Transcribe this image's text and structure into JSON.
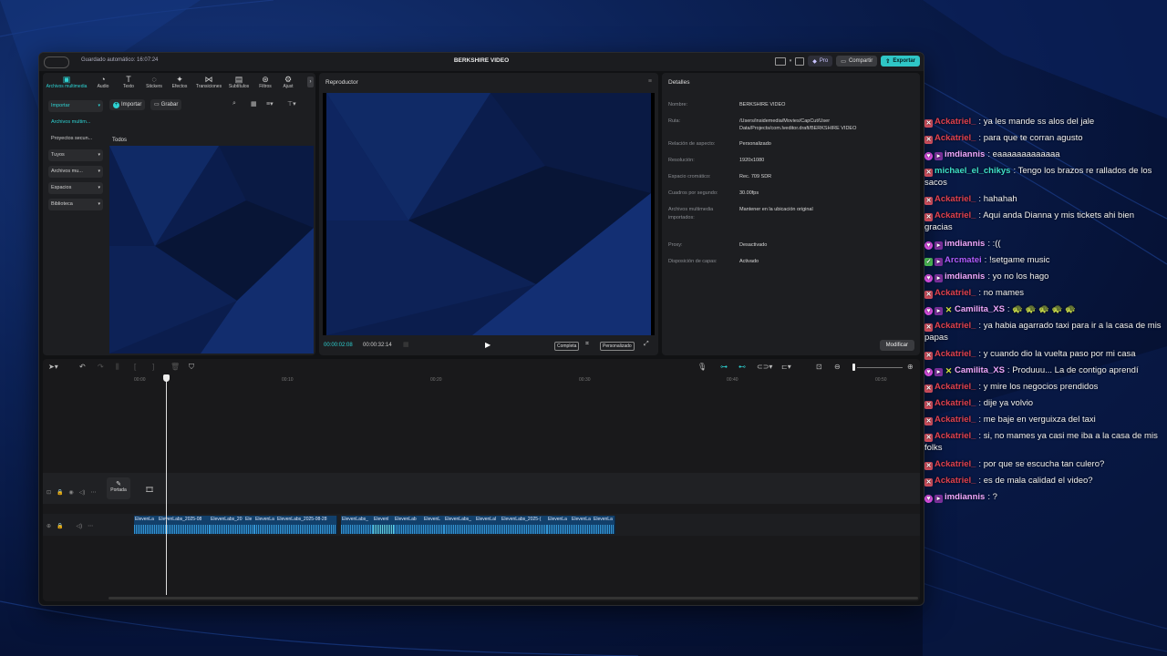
{
  "window": {
    "autosave": "Guardado automático: 16:07:24",
    "title": "BERKSHIRE VIDEO",
    "pro_label": "Pro",
    "share_label": "Compartir",
    "export_label": "Exportar"
  },
  "media": {
    "tools": [
      {
        "label": "Archivos multimedia",
        "icon": "▣"
      },
      {
        "label": "Audio",
        "icon": "◔"
      },
      {
        "label": "Texto",
        "icon": "T"
      },
      {
        "label": "Stickers",
        "icon": "◌"
      },
      {
        "label": "Efectos",
        "icon": "✦"
      },
      {
        "label": "Transiciones",
        "icon": "⋈"
      },
      {
        "label": "Subtítulos",
        "icon": "▤"
      },
      {
        "label": "Filtros",
        "icon": "⊛"
      },
      {
        "label": "Ajust",
        "icon": "⚙"
      }
    ],
    "sidebar": [
      {
        "label": "Importar"
      },
      {
        "label": "Archivos multim..."
      },
      {
        "label": "Proyectos secun..."
      },
      {
        "label": "Tuyos"
      },
      {
        "label": "Archivos mu..."
      },
      {
        "label": "Espacios"
      },
      {
        "label": "Biblioteca"
      }
    ],
    "import_label": "Importar",
    "record_label": "Grabar",
    "all_label": "Todos"
  },
  "player": {
    "title": "Reproductor",
    "current_time": "00:00:02:08",
    "total_time": "00:00:32:14",
    "full_label": "Completa",
    "custom_label": "Personalizado"
  },
  "details": {
    "title": "Detalles",
    "rows": [
      {
        "label": "Nombre:",
        "value": "BERKSHIRE VIDEO"
      },
      {
        "label": "Ruta:",
        "value": "/Users/insidemedia/Movies/CapCut/User Data/Projects/com.lveditor.draft/BERKSHIRE VIDEO"
      },
      {
        "label": "Relación de aspecto:",
        "value": "Personalizado"
      },
      {
        "label": "Resolución:",
        "value": "1920x1080"
      },
      {
        "label": "Espacio cromático:",
        "value": "Rec. 709 SDR"
      },
      {
        "label": "Cuadros por segundo:",
        "value": "30.00fps"
      },
      {
        "label": "Archivos multimedia importados:",
        "value": "Mantener en la ubicación original"
      },
      {
        "label": "Proxy:",
        "value": "Desactivado"
      },
      {
        "label": "Disposición de capas:",
        "value": "Activado"
      }
    ],
    "modify_label": "Modificar"
  },
  "timeline": {
    "ticks": [
      "00:00",
      "00:10",
      "00:20",
      "00:30",
      "00:40",
      "00:50"
    ],
    "cover_label": "Portada",
    "clips": [
      {
        "name": "ElevenLa"
      },
      {
        "name": "ElevenLabs_2025-08"
      },
      {
        "name": "ElevenLabs_20"
      },
      {
        "name": "Ele"
      },
      {
        "name": "ElevenLa"
      },
      {
        "name": "ElevenLabs_2025-08-28"
      },
      {
        "name": "ElevenLabs_"
      },
      {
        "name": "Elevenl"
      },
      {
        "name": "ElevenLab"
      },
      {
        "name": "ElevenL"
      },
      {
        "name": "ElevenLabs_"
      },
      {
        "name": "ElevenLal"
      },
      {
        "name": "ElevenLabs_2025-("
      },
      {
        "name": "ElevenLa"
      },
      {
        "name": "ElevenLa"
      },
      {
        "name": "ElevenLa"
      }
    ]
  },
  "chat": {
    "messages": [
      {
        "user": "Ackatriel_",
        "badges": [
          "mod"
        ],
        "color": "#e0414f",
        "text": "ya les mande ss alos del jale"
      },
      {
        "user": "Ackatriel_",
        "badges": [
          "mod"
        ],
        "color": "#e0414f",
        "text": "para que te corran agusto"
      },
      {
        "user": "imdiannis",
        "badges": [
          "sub",
          "vip"
        ],
        "color": "#f0a8ff",
        "text": "eaaaaaaaaaaaaa"
      },
      {
        "user": "michael_el_chikys",
        "badges": [
          "mod"
        ],
        "color": "#3fe0c8",
        "text": "Tengo los brazos re rallados de los sacos"
      },
      {
        "user": "Ackatriel_",
        "badges": [
          "mod"
        ],
        "color": "#e0414f",
        "text": "hahahah"
      },
      {
        "user": "Ackatriel_",
        "badges": [
          "mod"
        ],
        "color": "#e0414f",
        "text": "Aqui anda Dianna y mis tickets ahi bien gracias"
      },
      {
        "user": "imdiannis",
        "badges": [
          "sub",
          "vip"
        ],
        "color": "#f0a8ff",
        "text": ":(("
      },
      {
        "user": "Arcmatei",
        "badges": [
          "green",
          "vip"
        ],
        "color": "#b05cff",
        "text": "!setgame music"
      },
      {
        "user": "imdiannis",
        "badges": [
          "sub",
          "vip"
        ],
        "color": "#f0a8ff",
        "text": "yo no los hago"
      },
      {
        "user": "Ackatriel_",
        "badges": [
          "mod"
        ],
        "color": "#e0414f",
        "text": "no mames"
      },
      {
        "user": "Camilita_XS",
        "badges": [
          "sub",
          "vip",
          "x"
        ],
        "color": "#f0a8ff",
        "text": "🐢 🐢 🐢 🐢 🐢"
      },
      {
        "user": "Ackatriel_",
        "badges": [
          "mod"
        ],
        "color": "#e0414f",
        "text": "ya habia agarrado taxi para ir a la casa de mis papas"
      },
      {
        "user": "Ackatriel_",
        "badges": [
          "mod"
        ],
        "color": "#e0414f",
        "text": "y cuando dio la vuelta paso por mi casa"
      },
      {
        "user": "Camilita_XS",
        "badges": [
          "sub",
          "vip",
          "x"
        ],
        "color": "#f0a8ff",
        "text": "Produuu... La de contigo aprendí"
      },
      {
        "user": "Ackatriel_",
        "badges": [
          "mod"
        ],
        "color": "#e0414f",
        "text": "y mire los negocios prendidos"
      },
      {
        "user": "Ackatriel_",
        "badges": [
          "mod"
        ],
        "color": "#e0414f",
        "text": "dije ya volvio"
      },
      {
        "user": "Ackatriel_",
        "badges": [
          "mod"
        ],
        "color": "#e0414f",
        "text": "me baje en verguixza del taxi"
      },
      {
        "user": "Ackatriel_",
        "badges": [
          "mod"
        ],
        "color": "#e0414f",
        "text": "si, no mames ya casi me iba a la casa de mis folks"
      },
      {
        "user": "Ackatriel_",
        "badges": [
          "mod"
        ],
        "color": "#e0414f",
        "text": "por que se escucha tan culero?"
      },
      {
        "user": "Ackatriel_",
        "badges": [
          "mod"
        ],
        "color": "#e0414f",
        "text": "es de mala calidad el video?"
      },
      {
        "user": "imdiannis",
        "badges": [
          "sub",
          "vip"
        ],
        "color": "#f0a8ff",
        "text": "?"
      }
    ]
  },
  "colors": {
    "accent": "#2ed3d3",
    "clip": "#12406b"
  }
}
